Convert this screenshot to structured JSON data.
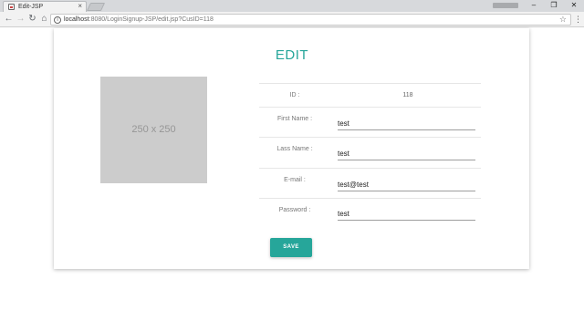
{
  "browser": {
    "tab_title": "Edit-JSP",
    "tab_close_glyph": "×",
    "url_host": "localhost",
    "url_rest": ":8080/LoginSignup-JSP/edit.jsp?CusID=118",
    "window_controls": {
      "minimize": "–",
      "maximize": "❐",
      "close": "✕"
    },
    "icons": [
      "back-arrow-icon",
      "forward-arrow-icon",
      "reload-icon",
      "home-icon",
      "info-icon",
      "star-icon",
      "menu-icon"
    ]
  },
  "page": {
    "title": "EDIT",
    "image_placeholder": "250 x 250",
    "accent_color": "#26a69a",
    "form": {
      "id_label": "ID :",
      "id_value": "118",
      "first_name_label": "First Name :",
      "first_name_value": "test",
      "last_name_label": "Lass Name :",
      "last_name_value": "test",
      "email_label": "E-mail :",
      "email_value": "test@test",
      "password_label": "Password :",
      "password_value": "test"
    },
    "save_label": "SAVE"
  }
}
